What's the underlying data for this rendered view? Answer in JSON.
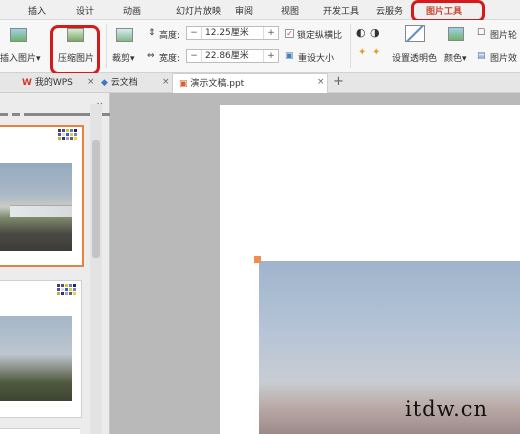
{
  "menu": {
    "tabs": [
      "插入",
      "设计",
      "动画",
      "幻灯片放映",
      "审阅",
      "视图",
      "开发工具",
      "云服务",
      "图片工具"
    ],
    "active_index": 8
  },
  "ribbon": {
    "insert_picture": "插入图片",
    "compress_picture": "压缩图片",
    "crop": "裁剪",
    "height_label": "高度:",
    "height_value": "12.25厘米",
    "width_label": "宽度:",
    "width_value": "22.86厘米",
    "lock_ratio": "锁定纵横比",
    "reset_size": "重设大小",
    "set_transparent": "设置透明色",
    "color": "颜色",
    "picture_outline": "图片轮",
    "picture_effect": "图片效",
    "minus": "−",
    "plus": "+",
    "dropdown_arrow": "▾",
    "checkmark": "✓"
  },
  "doc_tabs": {
    "my_wps": "我的WPS",
    "cloud_docs": "云文档",
    "active_doc": "演示文稿.ppt",
    "close": "×",
    "new_tab": "+"
  },
  "pane": {
    "close": "×"
  },
  "watermark": "itdw.cn",
  "colors": {
    "accent_red": "#d41a1a",
    "active_tab": "#c7482f",
    "handle": "#f08d4f"
  }
}
